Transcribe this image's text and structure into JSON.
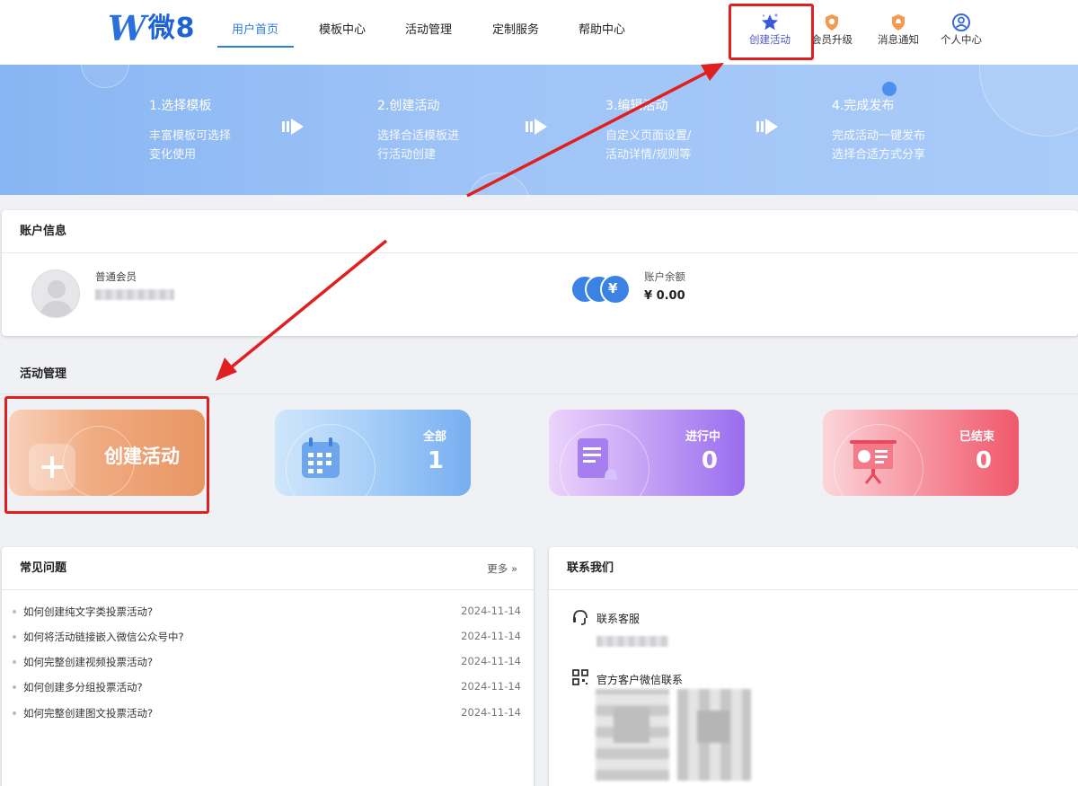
{
  "brand": {
    "logo_w": "W",
    "logo_text": "微8"
  },
  "nav": [
    {
      "label": "用户首页",
      "active": true
    },
    {
      "label": "模板中心"
    },
    {
      "label": "活动管理"
    },
    {
      "label": "定制服务"
    },
    {
      "label": "帮助中心"
    }
  ],
  "header_actions": [
    {
      "label": "创建活动",
      "icon": "star-icon"
    },
    {
      "label": "会员升级",
      "icon": "vip-badge-icon"
    },
    {
      "label": "消息通知",
      "icon": "bell-badge-icon"
    },
    {
      "label": "个人中心",
      "icon": "user-circle-icon"
    }
  ],
  "banner": {
    "steps": [
      {
        "title": "1.选择模板",
        "line1": "丰富模板可选择",
        "line2": "变化使用"
      },
      {
        "title": "2.创建活动",
        "line1": "选择合适模板进",
        "line2": "行活动创建"
      },
      {
        "title": "3.编辑活动",
        "line1": "自定义页面设置/",
        "line2": "活动详情/规则等"
      },
      {
        "title": "4.完成发布",
        "line1": "完成活动一键发布",
        "line2": "选择合适方式分享"
      }
    ]
  },
  "account": {
    "title": "账户信息",
    "member_level": "普通会员",
    "balance_label": "账户余额",
    "balance_value": "¥ 0.00",
    "currency_symbol": "¥"
  },
  "activity": {
    "title": "活动管理",
    "create_label": "创建活动",
    "stats": [
      {
        "label": "全部",
        "value": "1",
        "color": "#6aa8f0"
      },
      {
        "label": "进行中",
        "value": "0",
        "color": "#9b6cf0"
      },
      {
        "label": "已结束",
        "value": "0",
        "color": "#f45a6e"
      }
    ]
  },
  "faq": {
    "title": "常见问题",
    "more": "更多 »",
    "items": [
      {
        "q": "如何创建纯文字类投票活动?",
        "date": "2024-11-14"
      },
      {
        "q": "如何将活动链接嵌入微信公众号中?",
        "date": "2024-11-14"
      },
      {
        "q": "如何完整创建视频投票活动?",
        "date": "2024-11-14"
      },
      {
        "q": "如何创建多分组投票活动?",
        "date": "2024-11-14"
      },
      {
        "q": "如何完整创建图文投票活动?",
        "date": "2024-11-14"
      }
    ]
  },
  "contact": {
    "title": "联系我们",
    "service_label": "联系客服",
    "wechat_label": "官方客户微信联系"
  },
  "colors": {
    "accent": "#2b7de9",
    "highlight": "#e02020"
  }
}
